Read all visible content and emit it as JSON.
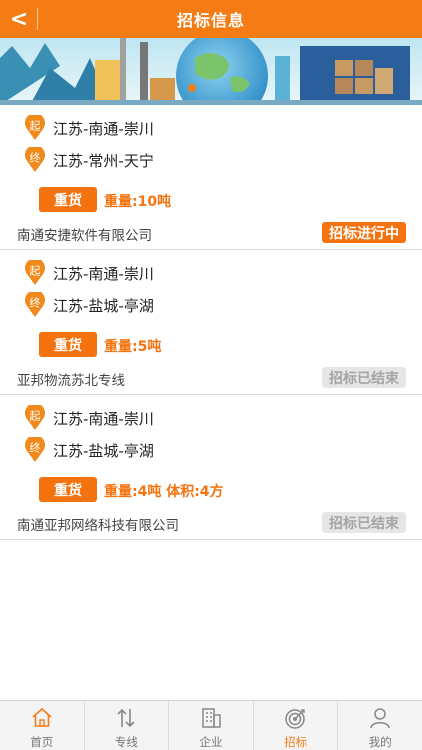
{
  "header": {
    "back_label": "<",
    "title": "招标信息"
  },
  "listings": [
    {
      "origin_mark": "起",
      "origin": "江苏-南通-崇川",
      "dest_mark": "终",
      "destination": "江苏-常州-天宁",
      "cargo_type": "重货",
      "details": "重量:10吨",
      "company": "南通安捷软件有限公司",
      "status": "招标进行中",
      "status_kind": "active"
    },
    {
      "origin_mark": "起",
      "origin": "江苏-南通-崇川",
      "dest_mark": "终",
      "destination": "江苏-盐城-亭湖",
      "cargo_type": "重货",
      "details": "重量:5吨",
      "company": "亚邦物流苏北专线",
      "status": "招标已结束",
      "status_kind": "ended"
    },
    {
      "origin_mark": "起",
      "origin": "江苏-南通-崇川",
      "dest_mark": "终",
      "destination": "江苏-盐城-亭湖",
      "cargo_type": "重货",
      "details": "重量:4吨 体积:4方",
      "company": "南通亚邦网络科技有限公司",
      "status": "招标已结束",
      "status_kind": "ended"
    }
  ],
  "tabbar": {
    "items": [
      {
        "label": "首页",
        "icon": "home-icon"
      },
      {
        "label": "专线",
        "icon": "route-icon"
      },
      {
        "label": "企业",
        "icon": "building-icon"
      },
      {
        "label": "招标",
        "icon": "target-icon",
        "active": true
      },
      {
        "label": "我的",
        "icon": "user-icon"
      }
    ]
  },
  "colors": {
    "accent": "#f57c14",
    "ended_bg": "#e6e6e6",
    "ended_text": "#a5a5a5"
  }
}
